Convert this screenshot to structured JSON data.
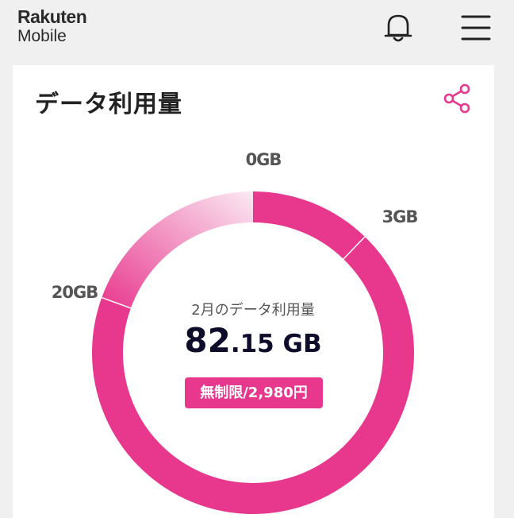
{
  "header": {
    "logo_line1": "Rakuten",
    "logo_line2": "Mobile",
    "notification_icon": "bell-icon",
    "menu_icon": "hamburger-menu-icon"
  },
  "card": {
    "title": "データ利用量",
    "share_icon": "share-icon"
  },
  "usage": {
    "caption": "2月のデータ利用量",
    "value_integer": "82",
    "value_decimal": ".15 GB",
    "plan_badge": "無制限/2,980円"
  },
  "colors": {
    "accent": "#e8388e",
    "track": "#e0e0e0",
    "background": "#f0f0f0"
  },
  "chart_data": {
    "type": "donut",
    "tiers": [
      {
        "label": "0GB",
        "value_gb": 0
      },
      {
        "label": "3GB",
        "value_gb": 3
      },
      {
        "label": "20GB",
        "value_gb": 20
      }
    ],
    "used_gb": 82.15,
    "unit": "GB"
  }
}
